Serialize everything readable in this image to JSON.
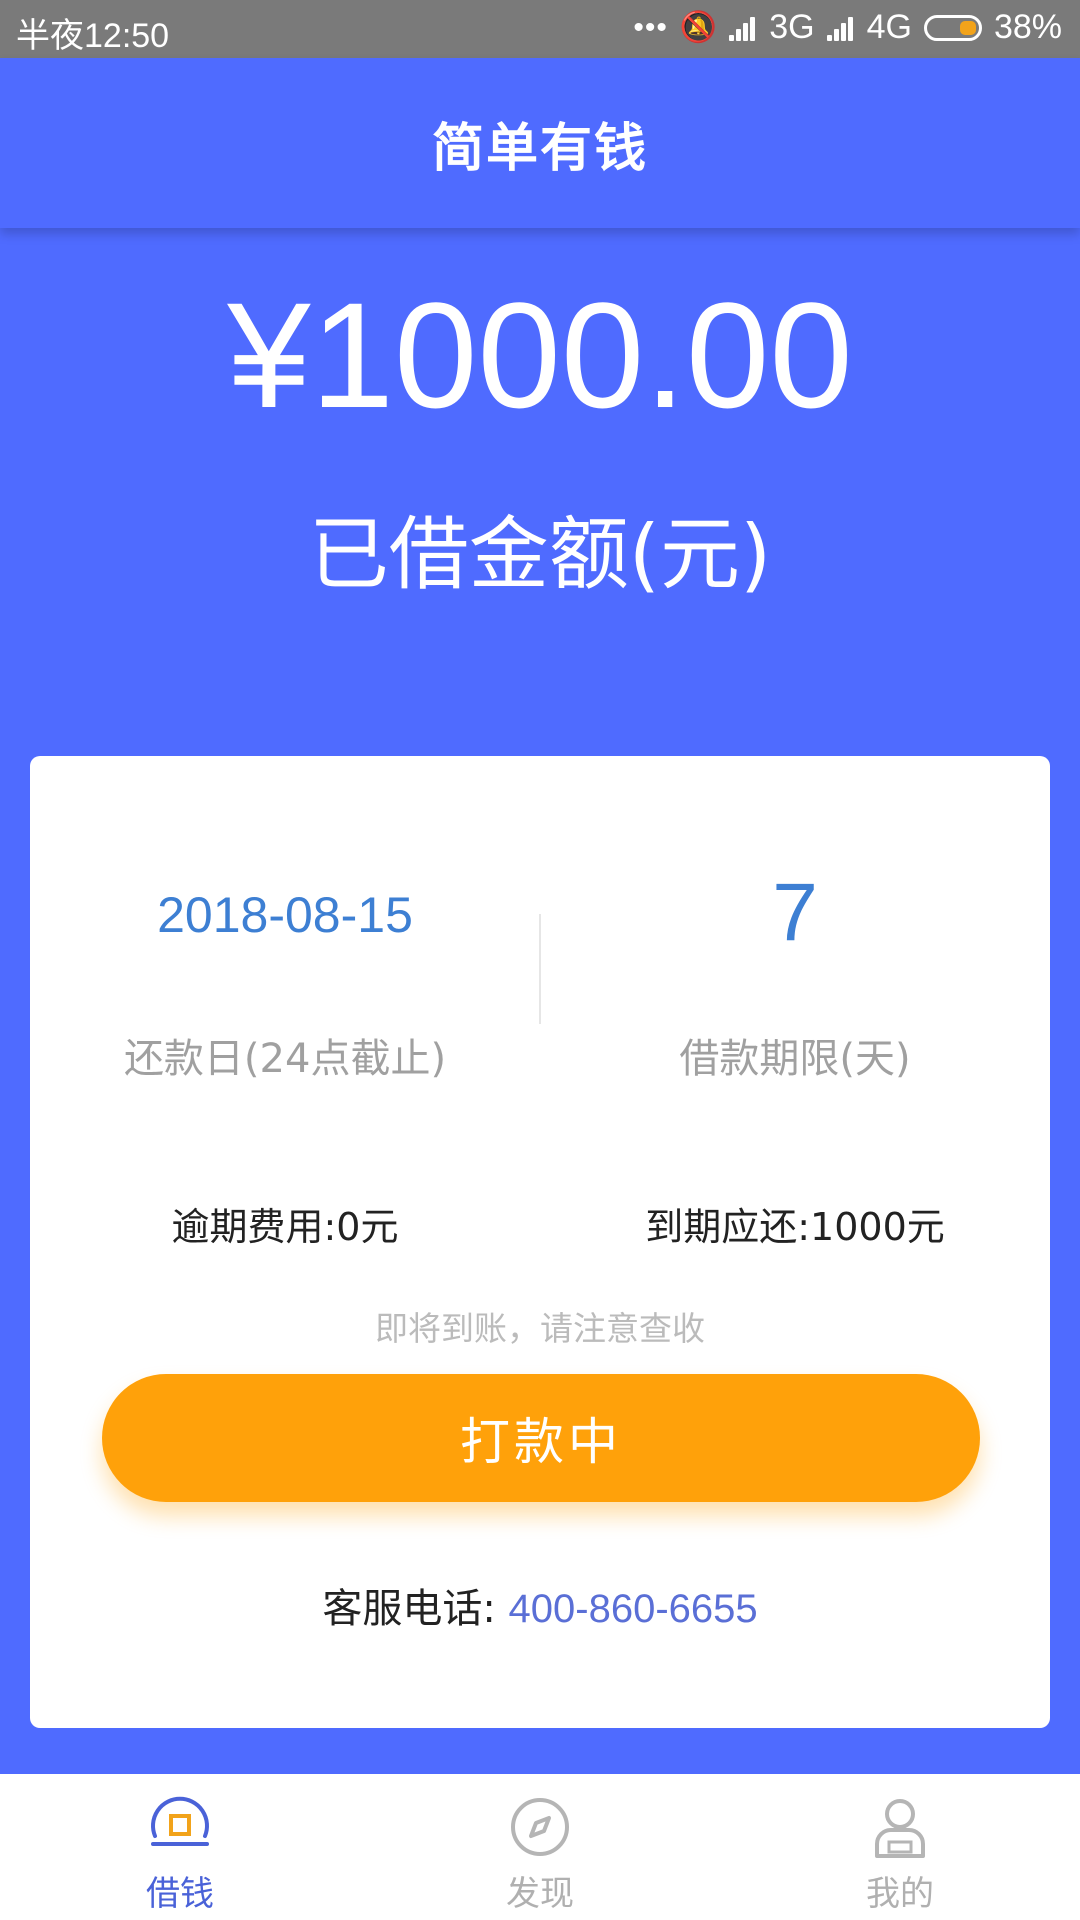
{
  "status_bar": {
    "time": "半夜12:50",
    "dots": "•••",
    "network_1": "3G",
    "network_2": "4G",
    "battery": "38%"
  },
  "header": {
    "title": "简单有钱"
  },
  "loan": {
    "amount": "¥1000.00",
    "amount_label": "已借金额(元)"
  },
  "card": {
    "repay_date": "2018-08-15",
    "repay_date_label": "还款日(24点截止)",
    "term": "7",
    "term_label": "借款期限(天)",
    "overdue_fee": "逾期费用:0元",
    "due_amount": "到期应还:1000元",
    "hint": "即将到账，请注意查收",
    "button_label": "打款中",
    "service_label": "客服电话:",
    "service_phone": "400-860-6655"
  },
  "nav": {
    "items": [
      {
        "label": "借钱",
        "icon": "loan-icon",
        "active": true
      },
      {
        "label": "发现",
        "icon": "compass-icon",
        "active": false
      },
      {
        "label": "我的",
        "icon": "user-icon",
        "active": false
      }
    ]
  },
  "colors": {
    "primary": "#4f6bff",
    "accent": "#ffa10a",
    "value_blue": "#3d7fd3",
    "nav_active": "#4a62d8"
  }
}
